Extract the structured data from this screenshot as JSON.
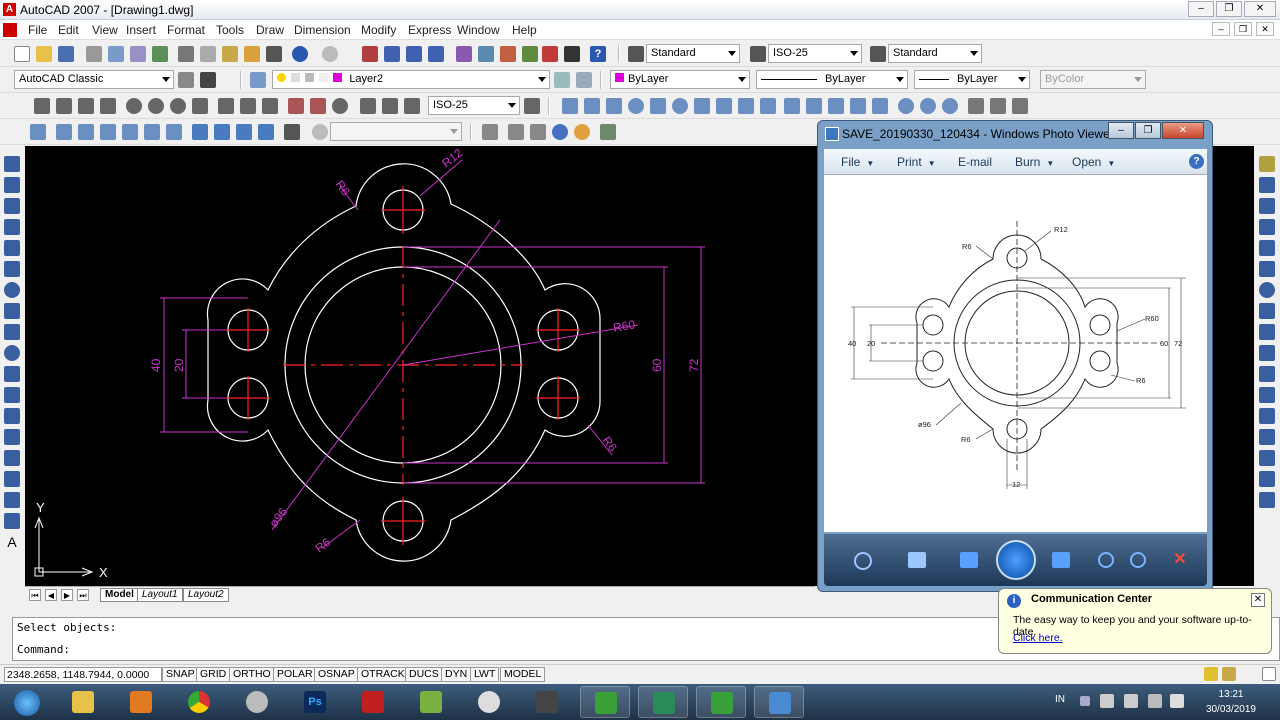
{
  "window": {
    "title": "AutoCAD 2007 - [Drawing1.dwg]"
  },
  "menu": [
    "File",
    "Edit",
    "View",
    "Insert",
    "Format",
    "Tools",
    "Draw",
    "Dimension",
    "Modify",
    "Express",
    "Window",
    "Help"
  ],
  "styles": {
    "text_style": "Standard",
    "dim_style": "ISO-25",
    "table_style": "Standard"
  },
  "workspace": "AutoCAD Classic",
  "layer": "Layer2",
  "properties": {
    "color": "ByLayer",
    "linetype": "ByLayer",
    "lineweight": "ByLayer",
    "plotstyle": "ByColor"
  },
  "dim_toolbar": {
    "dimstyle": "ISO-25"
  },
  "canvas": {
    "dims": {
      "r12": "R12",
      "r6a": "R6",
      "r60": "R60",
      "d40": "40",
      "d20": "20",
      "d60": "60",
      "d72": "72",
      "r6b": "R6",
      "phi96": "ø96",
      "r6c": "R6"
    },
    "ucs": {
      "y": "Y",
      "x": "X"
    }
  },
  "layout_tabs": [
    "Model",
    "Layout1",
    "Layout2"
  ],
  "command": {
    "line1": "Select objects:",
    "line2": "Command:"
  },
  "status": {
    "coords": "2348.2658, 1148.7944, 0.0000",
    "toggles": [
      "SNAP",
      "GRID",
      "ORTHO",
      "POLAR",
      "OSNAP",
      "OTRACK",
      "DUCS",
      "DYN",
      "LWT",
      "MODEL"
    ]
  },
  "photo_viewer": {
    "title": "SAVE_20190330_120434 - Windows Photo Viewer",
    "menu": [
      "File",
      "Print",
      "E-mail",
      "Burn",
      "Open"
    ],
    "dims": {
      "r12": "R12",
      "r6a": "R6",
      "r60": "R60",
      "d40": "40",
      "d20": "20",
      "d60": "60",
      "d72": "72",
      "r6b": "R6",
      "phi96": "ø96",
      "r6c": "R6",
      "d12": "12"
    }
  },
  "notification": {
    "title": "Communication Center",
    "body": "The easy way to keep you and your software up-to-date.",
    "link": "Click here."
  },
  "taskbar": {
    "lang": "IN",
    "time": "13:21",
    "date": "30/03/2019"
  },
  "colors": {
    "canvas": "#000000",
    "geometry": "#ffffff",
    "dimension": "#cc33cc",
    "centerline": "#ff2020",
    "taskbar": "#2a4560"
  }
}
